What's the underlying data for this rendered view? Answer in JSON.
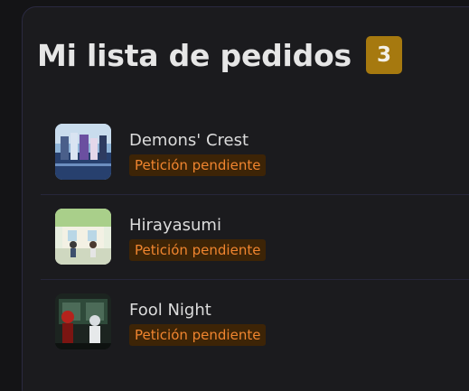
{
  "header": {
    "title": "Mi lista de pedidos",
    "count": "3"
  },
  "requests": [
    {
      "title": "Demons' Crest",
      "status": "Petición pendiente",
      "cover_icon": "demons-crest-cover"
    },
    {
      "title": "Hirayasumi",
      "status": "Petición pendiente",
      "cover_icon": "hirayasumi-cover"
    },
    {
      "title": "Fool Night",
      "status": "Petición pendiente",
      "cover_icon": "fool-night-cover"
    }
  ],
  "colors": {
    "badge": "#a6790f",
    "status_bg": "#3d2406",
    "status_text": "#f0852f"
  }
}
